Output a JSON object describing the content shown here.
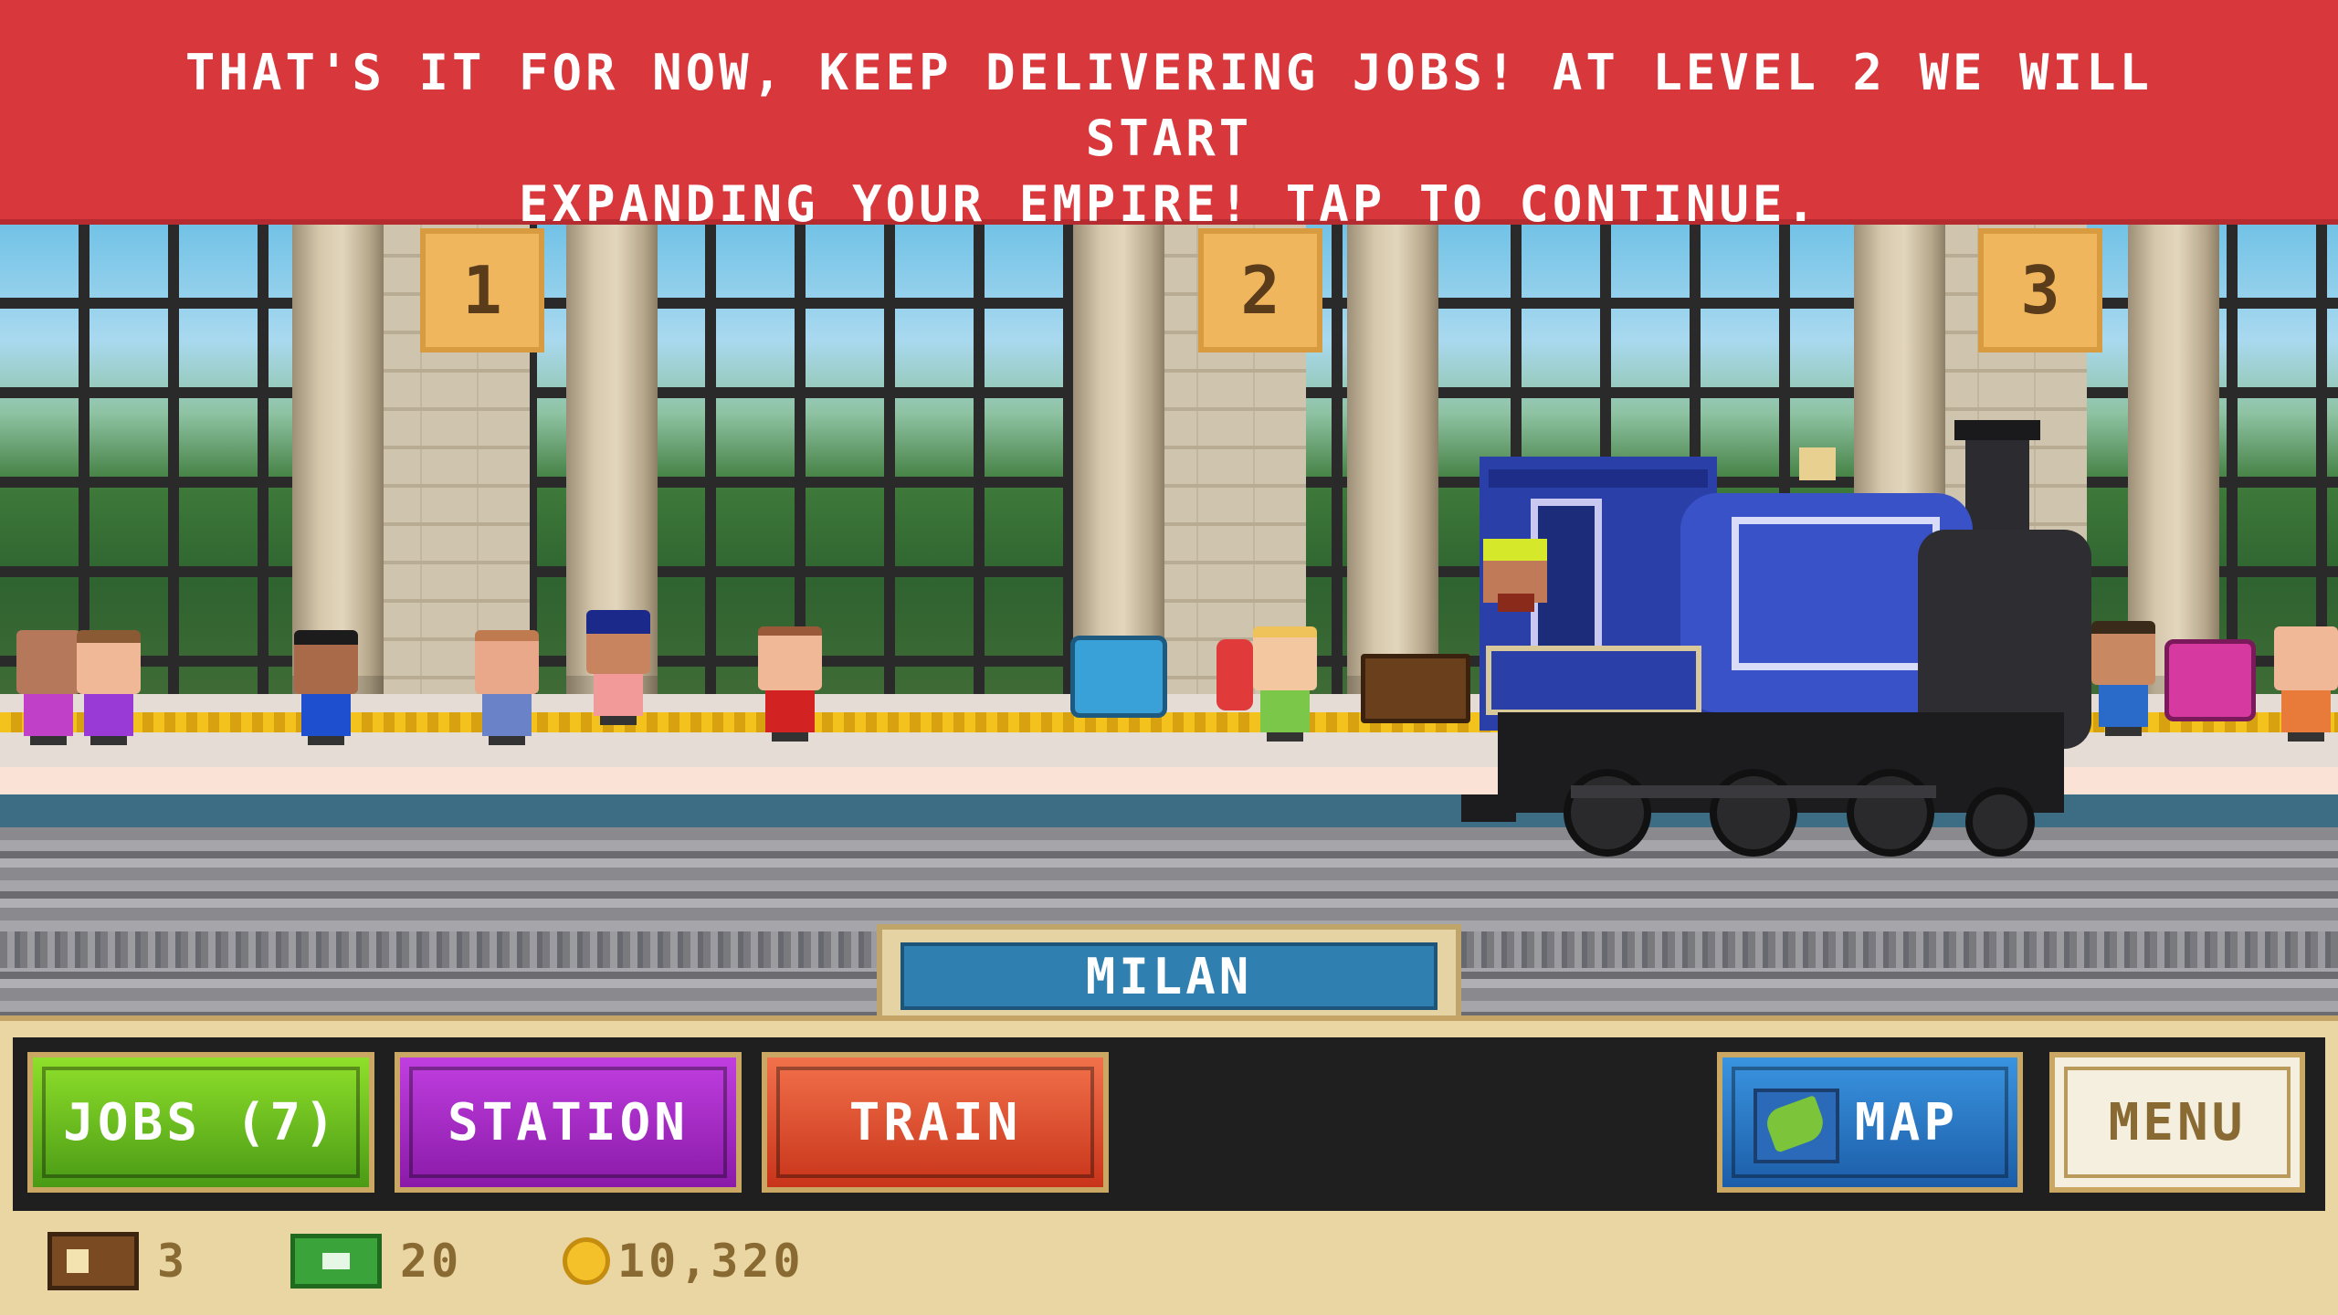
{
  "banner": {
    "message_line1": "THAT'S IT FOR NOW, KEEP DELIVERING JOBS! AT LEVEL 2 WE WILL START",
    "message_line2": "EXPANDING YOUR EMPIRE! TAP TO CONTINUE."
  },
  "platform_signs": [
    "1",
    "2",
    "3"
  ],
  "station": {
    "name": "MILAN"
  },
  "buttons": {
    "jobs": "JOBS (7)",
    "station": "STATION",
    "train": "TRAIN",
    "map": "MAP",
    "menu": "MENU"
  },
  "stats": {
    "tickets": "3",
    "cash": "20",
    "coins": "10,320"
  },
  "icons": {
    "tickets": "ticket-icon",
    "cash": "cash-icon",
    "coins": "coin-icon",
    "map": "map-icon"
  },
  "colors": {
    "banner": "#d8373c",
    "jobs": "#5aa81a",
    "station": "#9a28b8",
    "train": "#e0502e",
    "map": "#2a78c8",
    "station_label": "#2f7fb0"
  }
}
